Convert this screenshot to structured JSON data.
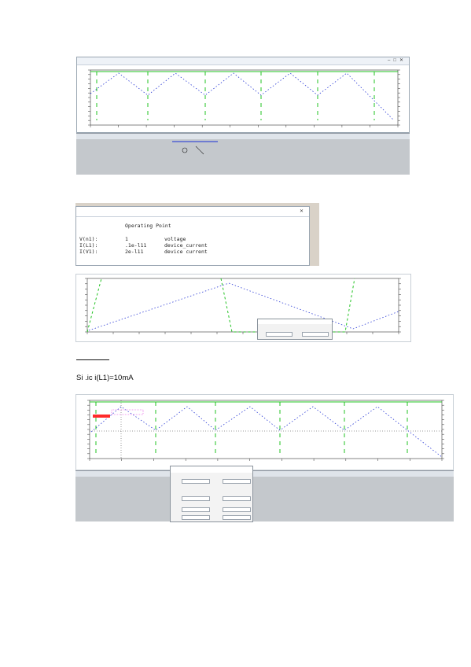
{
  "caption": "Si .ic i(L1)=10mA",
  "op_window": {
    "title": "Operating Point",
    "rows": [
      {
        "name": "V(n1):",
        "value": "1",
        "type": "voltage"
      },
      {
        "name": "I(L1):",
        "value": ".1e-l11",
        "type": "device_current"
      },
      {
        "name": "I(V1):",
        "value": "2e-l11",
        "type": "device current"
      }
    ]
  },
  "colors": {
    "green": "#22c322",
    "blue": "#2b3bd6",
    "window_border": "#9aa6b2",
    "panel": "#c4c8cc"
  }
}
